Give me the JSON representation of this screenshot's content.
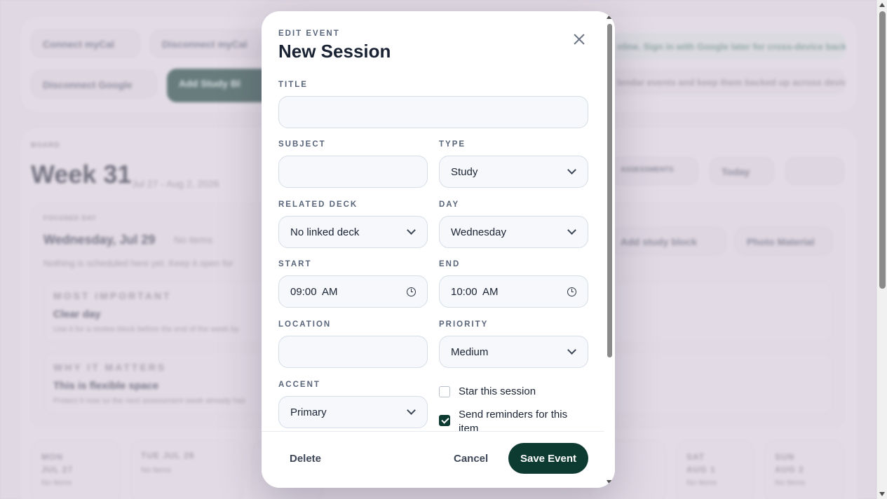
{
  "background": {
    "toolbar": {
      "connect_mycal": "Connect myCal",
      "disconnect_mycal": "Disconnect myCal",
      "disconnect_google": "Disconnect Google",
      "add_study_block": "Add Study Bl",
      "banner_1": "nline. Sign in with Google later for cross-device backup.",
      "banner_2": "lendar events and keep them backed up across devices."
    },
    "planner": {
      "kicker": "BOARD",
      "week_title": "Week 31",
      "date_range": "Jul 27 - Aug 2, 2026",
      "assessments": "ASSESSMENTS",
      "today": "Today",
      "focused_kicker": "FOCUSED DAY",
      "focused_day": "Wednesday, Jul 29",
      "no_items": "No items",
      "nothing_scheduled": "Nothing is scheduled here yet. Keep it open for",
      "add_study_block": "Add study block",
      "photo_material": "Photo Material",
      "most_important_kicker": "MOST IMPORTANT",
      "most_important_title": "Clear day",
      "most_important_desc": "Use it for a review block before the end of the week by",
      "why_kicker": "WHY IT MATTERS",
      "why_title": "This is flexible space",
      "why_desc": "Protect it now so the next assessment week already has"
    },
    "days": [
      {
        "label": "MON JUL 27",
        "sub": "No items"
      },
      {
        "label": "TUE JUL 28",
        "sub": "No items"
      },
      {
        "label": "SAT AUG 1",
        "sub": "No items"
      },
      {
        "label": "SUN AUG 2",
        "sub": "No items"
      }
    ]
  },
  "modal": {
    "kicker": "EDIT EVENT",
    "title": "New Session",
    "fields": {
      "title_label": "TITLE",
      "title_value": "",
      "subject_label": "SUBJECT",
      "subject_value": "",
      "type_label": "TYPE",
      "type_value": "Study",
      "deck_label": "RELATED DECK",
      "deck_value": "No linked deck",
      "day_label": "DAY",
      "day_value": "Wednesday",
      "start_label": "START",
      "start_value": "09:00  AM",
      "end_label": "END",
      "end_value": "10:00  AM",
      "location_label": "LOCATION",
      "location_value": "",
      "priority_label": "PRIORITY",
      "priority_value": "Medium",
      "accent_label": "ACCENT",
      "accent_value": "Primary"
    },
    "checks": {
      "star_label": "Star this session",
      "star_checked": false,
      "remind_label": "Send reminders for this item",
      "remind_checked": true
    },
    "footer": {
      "delete": "Delete",
      "cancel": "Cancel",
      "save": "Save Event"
    }
  },
  "colors": {
    "primary": "#0e3b31",
    "label": "#59657a",
    "field_border": "#d6dee8"
  }
}
